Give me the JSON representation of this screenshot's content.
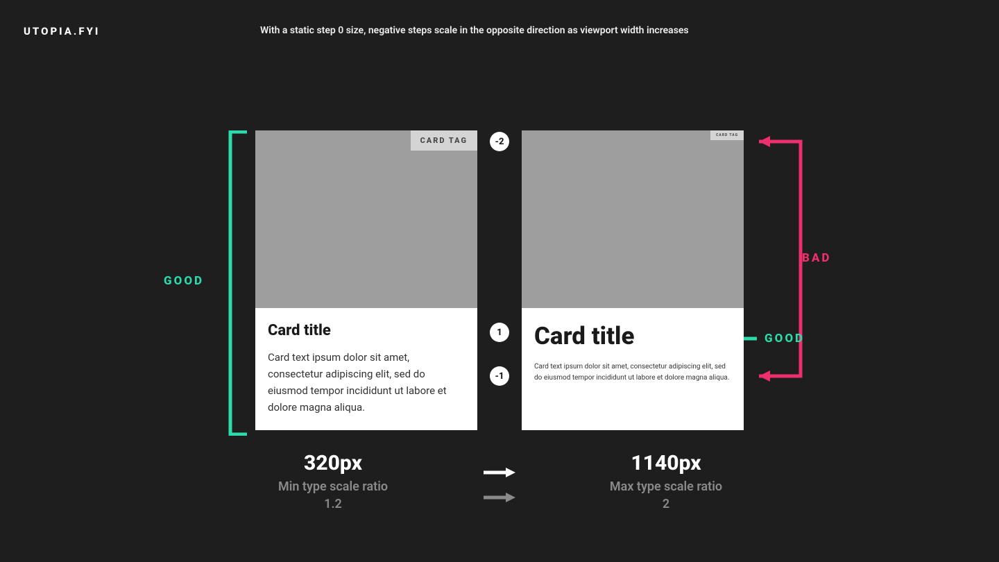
{
  "brand": "UTOPIA.FYI",
  "subtitle": "With a static step 0 size, negative steps scale in the opposite direction as viewport width increases",
  "labels": {
    "good": "GOOD",
    "bad": "BAD"
  },
  "steps": {
    "neg2": "-2",
    "one": "1",
    "neg1": "-1"
  },
  "card": {
    "tag": "CARD TAG",
    "title": "Card title",
    "text": "Card text ipsum dolor sit amet, consectetur adipiscing elit, sed do eiusmod tempor incididunt ut labore et dolore magna aliqua."
  },
  "bottom": {
    "left": {
      "px": "320px",
      "label": "Min type scale ratio",
      "value": "1.2"
    },
    "right": {
      "px": "1140px",
      "label": "Max type scale ratio",
      "value": "2"
    }
  },
  "colors": {
    "good": "#2bdbaa",
    "bad": "#ee2f6e",
    "bg": "#1e1e1e"
  }
}
